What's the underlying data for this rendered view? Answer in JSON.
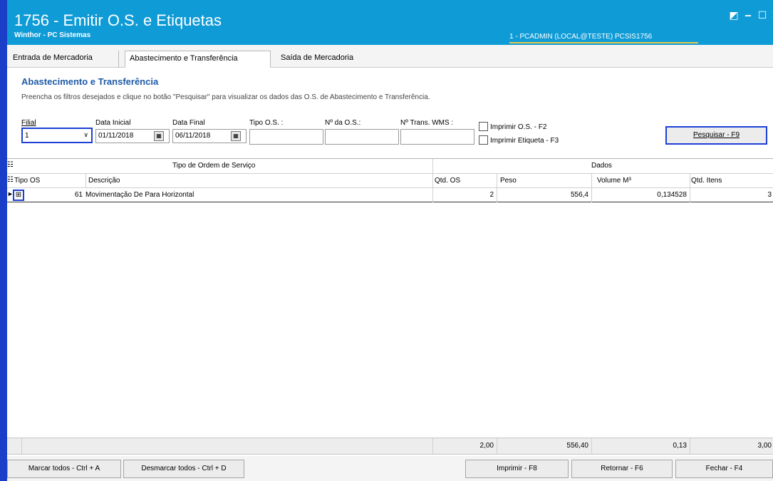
{
  "window": {
    "title": "1756 - Emitir O.S. e Etiquetas",
    "subtitle": "Winthor - PC Sistemas",
    "user_info": "1 - PCADMIN (LOCAL@TESTE)  PCSIS1756",
    "controls": {
      "restore": "◩",
      "minimize": "‒",
      "maximize": "☐",
      "close": "✕"
    }
  },
  "tabs": [
    {
      "label": "Entrada de Mercadoria"
    },
    {
      "label": "Abastecimento e Transferência"
    },
    {
      "label": "Saída de Mercadoria"
    }
  ],
  "section": {
    "title": "Abastecimento e Transferência",
    "description": "Preencha os filtros desejados e clique no botão \"Pesquisar\" para visualizar os dados das O.S. de Abastecimento e Transferência."
  },
  "filters": {
    "filial_label": "Filial",
    "filial_value": "1",
    "data_inicial_label": "Data Inicial",
    "data_inicial_value": "01/11/2018",
    "data_final_label": "Data Final",
    "data_final_value": "06/11/2018",
    "tipo_os_label": "Tipo O.S. :",
    "num_os_label": "Nº da O.S.:",
    "num_trans_label": "Nº Trans. WMS :",
    "imprimir_os_label": "Imprimir O.S. - F2",
    "imprimir_etiqueta_label": "Imprimir Etiqueta - F3",
    "pesquisar_label": "Pesquisar - F9"
  },
  "grid": {
    "group_left": "Tipo de Ordem de Serviço",
    "group_right": "Dados",
    "columns": [
      "Tipo OS",
      "Descrição",
      "Qtd. OS",
      "Peso",
      "Volume M³",
      "Qtd. Itens"
    ],
    "rows": [
      {
        "tipo_os": "61",
        "descricao": "Movimentação De Para Horizontal",
        "qtd_os": "2",
        "peso": "556,4",
        "volume": "0,134528",
        "qtd_itens": "3"
      }
    ],
    "totals": {
      "qtd_os": "2,00",
      "peso": "556,40",
      "volume": "0,13",
      "qtd_itens": "3,00"
    }
  },
  "bottom_buttons": {
    "marcar": "Marcar todos - Ctrl + A",
    "desmarcar": "Desmarcar todos - Ctrl + D",
    "imprimir": "Imprimir - F8",
    "retornar": "Retornar - F6",
    "fechar": "Fechar - F4"
  },
  "colors": {
    "titlebar": "#0f9bd6",
    "section_title": "#1f5aa6",
    "focus_border": "#1e3fd6"
  }
}
